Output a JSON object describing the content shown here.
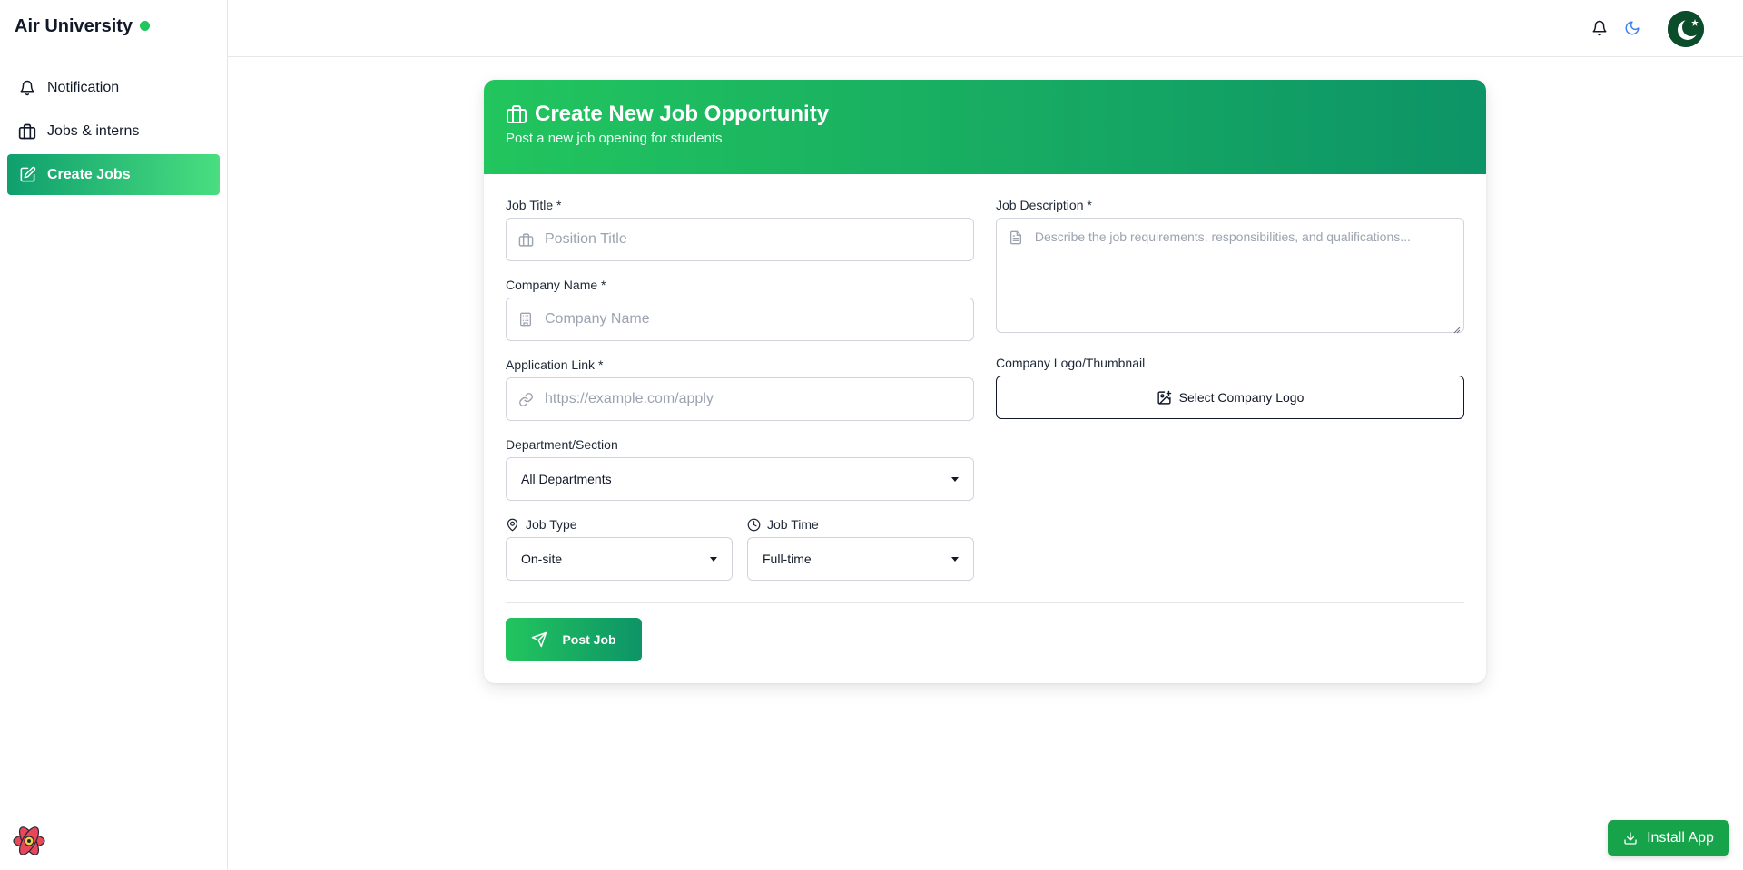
{
  "sidebar": {
    "brand": "Air University",
    "items": [
      {
        "label": "Notification",
        "icon": "bell-icon"
      },
      {
        "label": "Jobs & interns",
        "icon": "briefcase-icon"
      },
      {
        "label": "Create Jobs",
        "icon": "edit-icon",
        "active": true
      }
    ]
  },
  "colors": {
    "accent": "#22c55e",
    "accent_dark": "#0d9467",
    "text": "#111827"
  },
  "form": {
    "title": "Create New Job Opportunity",
    "subtitle": "Post a new job opening for students",
    "job_title": {
      "label": "Job Title *",
      "placeholder": "Position Title"
    },
    "company_name": {
      "label": "Company Name *",
      "placeholder": "Company Name"
    },
    "application_link": {
      "label": "Application Link *",
      "placeholder": "https://example.com/apply"
    },
    "department": {
      "label": "Department/Section",
      "value": "All Departments"
    },
    "job_type": {
      "label": "Job Type",
      "value": "On-site"
    },
    "job_time": {
      "label": "Job Time",
      "value": "Full-time"
    },
    "job_description": {
      "label": "Job Description *",
      "placeholder": "Describe the job requirements, responsibilities, and qualifications..."
    },
    "company_logo": {
      "label": "Company Logo/Thumbnail",
      "button": "Select Company Logo"
    },
    "submit": "Post Job"
  },
  "install_app": "Install App"
}
